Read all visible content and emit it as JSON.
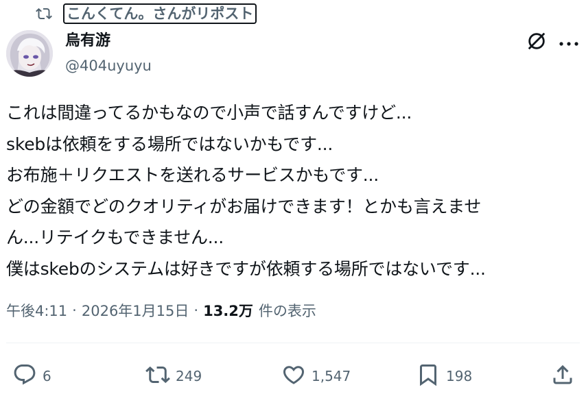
{
  "repost": {
    "label": "こんくてん。さんがリポスト",
    "icon": "repost-icon"
  },
  "author": {
    "display_name": "烏有游",
    "handle": "@404uyuyu",
    "avatar_icon": "avatar"
  },
  "header_actions": {
    "grok_icon": "grok-icon",
    "more_icon": "more-icon"
  },
  "tweet": {
    "lines": [
      "これは間違ってるかもなので小声で話すんですけど...",
      "skebは依頼をする場所ではないかもです...",
      "お布施＋リクエストを送れるサービスかもです...",
      "どの金額でどのクオリティがお届けできます！とかも言えませ",
      "ん...リテイクもできません...",
      "僕はskebのシステムは好きですが依頼する場所ではないです..."
    ]
  },
  "meta": {
    "time": "午後4:11",
    "separator": "·",
    "date": "2026年1月15日",
    "views_count": "13.2万",
    "views_label": "件の表示"
  },
  "actions": {
    "reply": {
      "count": "6",
      "icon": "reply-icon"
    },
    "retweet": {
      "count": "249",
      "icon": "retweet-icon"
    },
    "like": {
      "count": "1,547",
      "icon": "heart-icon"
    },
    "bookmark": {
      "count": "198",
      "icon": "bookmark-icon"
    },
    "share": {
      "icon": "share-icon"
    }
  },
  "colors": {
    "text": "#0f1419",
    "secondary": "#536471",
    "divider": "#eff3f4"
  }
}
